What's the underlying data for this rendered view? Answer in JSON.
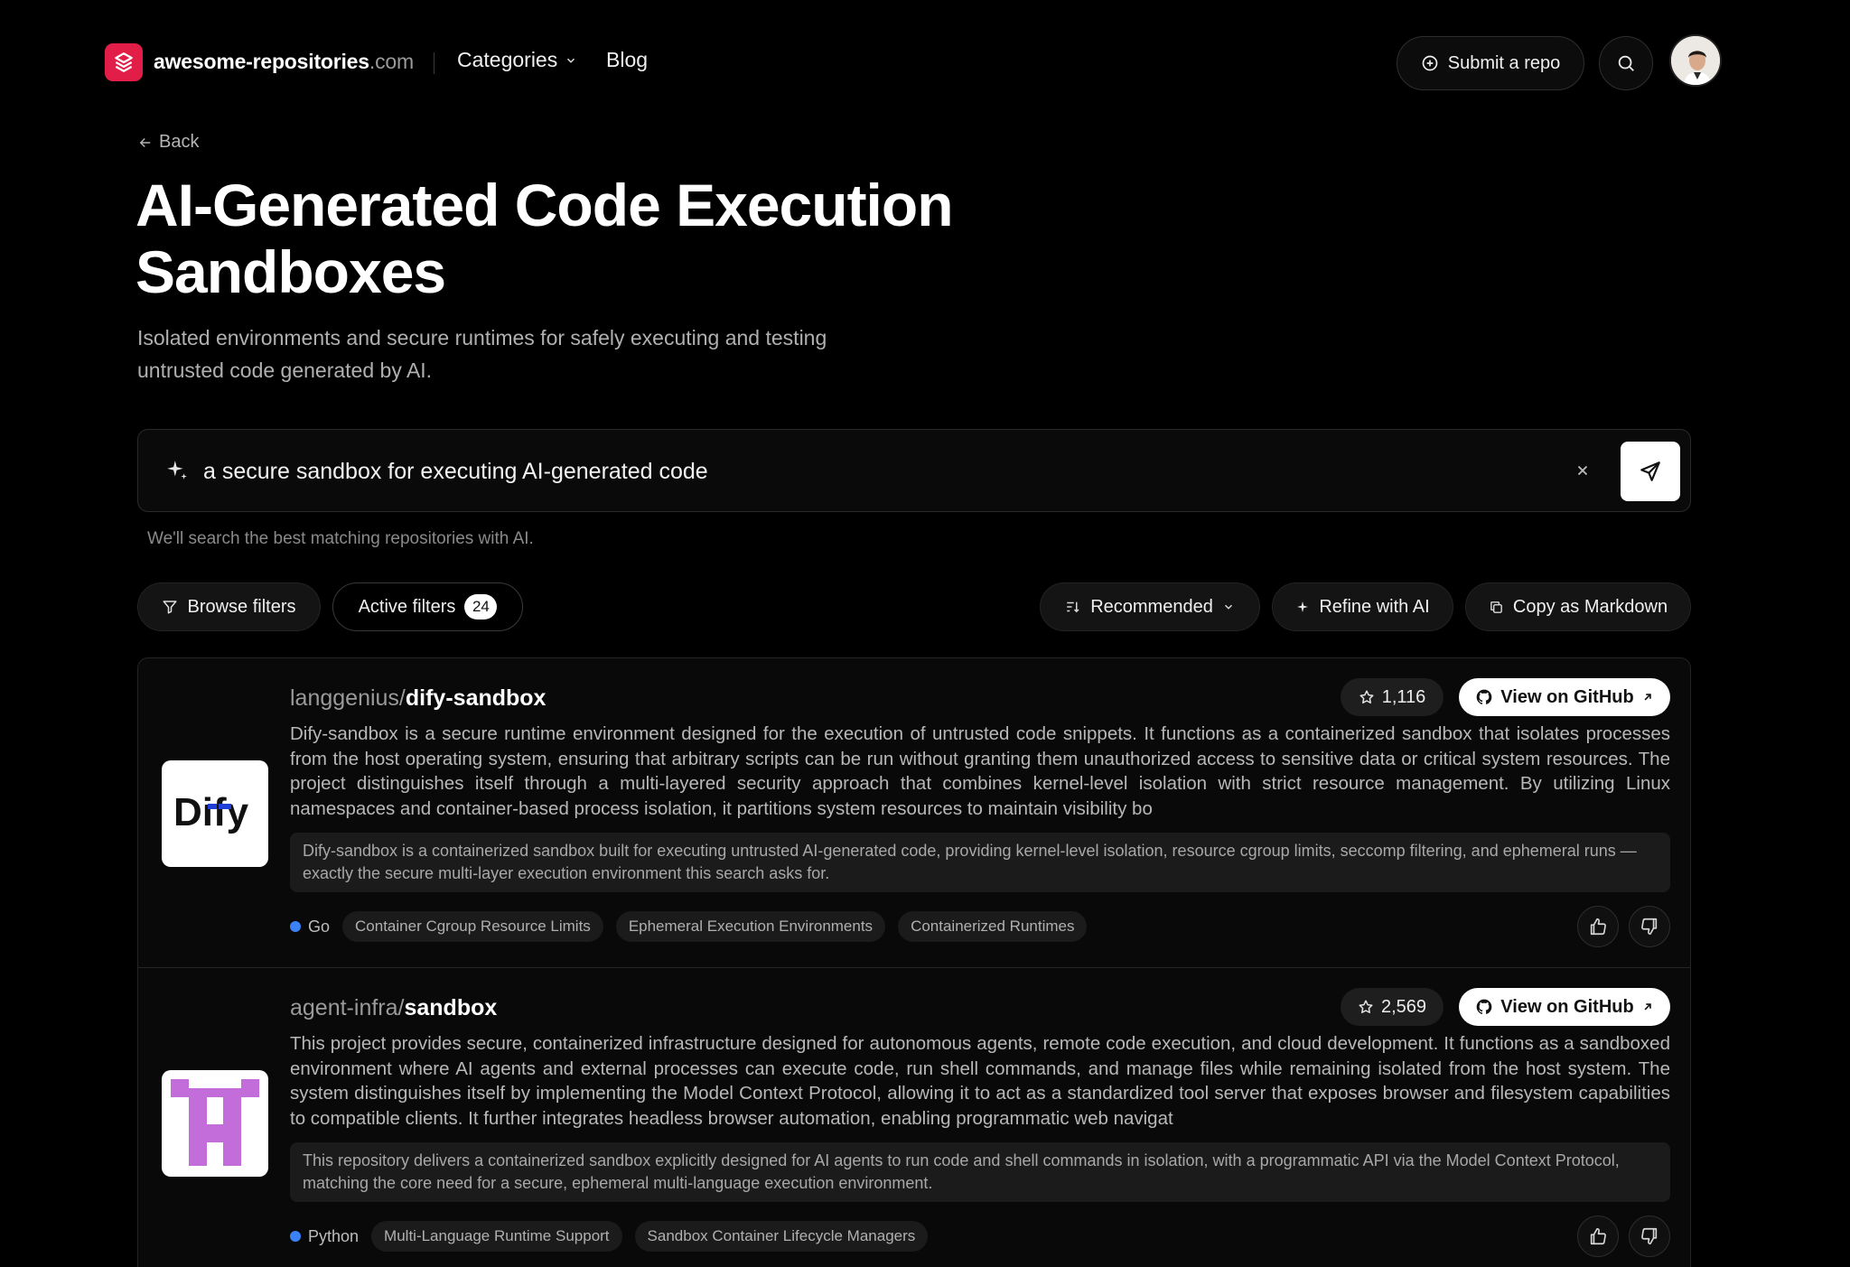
{
  "header": {
    "brand": "awesome-repositories",
    "brand_tld": ".com",
    "nav_categories": "Categories",
    "nav_blog": "Blog",
    "submit_label": "Submit a repo"
  },
  "page": {
    "back_label": "Back",
    "title_line1": "AI-Generated Code Execution",
    "title_line2": "Sandboxes",
    "subtitle": "Isolated environments and secure runtimes for safely executing and testing untrusted code generated by AI."
  },
  "search": {
    "value": "a secure sandbox for executing AI-generated code",
    "hint": "We'll search the best matching repositories with AI."
  },
  "filters": {
    "browse_label": "Browse filters",
    "active_label": "Active filters",
    "active_count": "24",
    "sort_label": "Recommended",
    "refine_label": "Refine with AI",
    "copy_label": "Copy as Markdown"
  },
  "results": [
    {
      "owner": "langgenius/",
      "repo": "dify-sandbox",
      "logo_text": "Dify",
      "stars": "1,116",
      "github_label": "View on GitHub",
      "description": "Dify-sandbox is a secure runtime environment designed for the execution of untrusted code snippets. It functions as a containerized sandbox that isolates processes from the host operating system, ensuring that arbitrary scripts can be run without granting them unauthorized access to sensitive data or critical system resources. The project distinguishes itself through a multi-layered security approach that combines kernel-level isolation with strict resource management. By utilizing Linux namespaces and container-based process isolation, it partitions system resources to maintain visibility bo",
      "ai_note": "Dify-sandbox is a containerized sandbox built for executing untrusted AI-generated code, providing kernel-level isolation, resource cgroup limits, seccomp filtering, and ephemeral runs — exactly the secure multi-layer execution environment this search asks for.",
      "language": "Go",
      "tags": [
        "Container Cgroup Resource Limits",
        "Ephemeral Execution Environments",
        "Containerized Runtimes"
      ]
    },
    {
      "owner": "agent-infra/",
      "repo": "sandbox",
      "stars": "2,569",
      "github_label": "View on GitHub",
      "description": "This project provides secure, containerized infrastructure designed for autonomous agents, remote code execution, and cloud development. It functions as a sandboxed environment where AI agents and external processes can execute code, run shell commands, and manage files while remaining isolated from the host system. The system distinguishes itself by implementing the Model Context Protocol, allowing it to act as a standardized tool server that exposes browser and filesystem capabilities to compatible clients. It further integrates headless browser automation, enabling programmatic web navigat",
      "ai_note": "This repository delivers a containerized sandbox explicitly designed for AI agents to run code and shell commands in isolation, with a programmatic API via the Model Context Protocol, matching the core need for a secure, ephemeral multi-language execution environment.",
      "language": "Python",
      "tags": [
        "Multi-Language Runtime Support",
        "Sandbox Container Lifecycle Managers"
      ]
    }
  ],
  "colors": {
    "brand": "#e11d48",
    "go_dot": "#3b82f6",
    "python_dot": "#3b82f6",
    "agent_logo": "#c36ddb"
  }
}
